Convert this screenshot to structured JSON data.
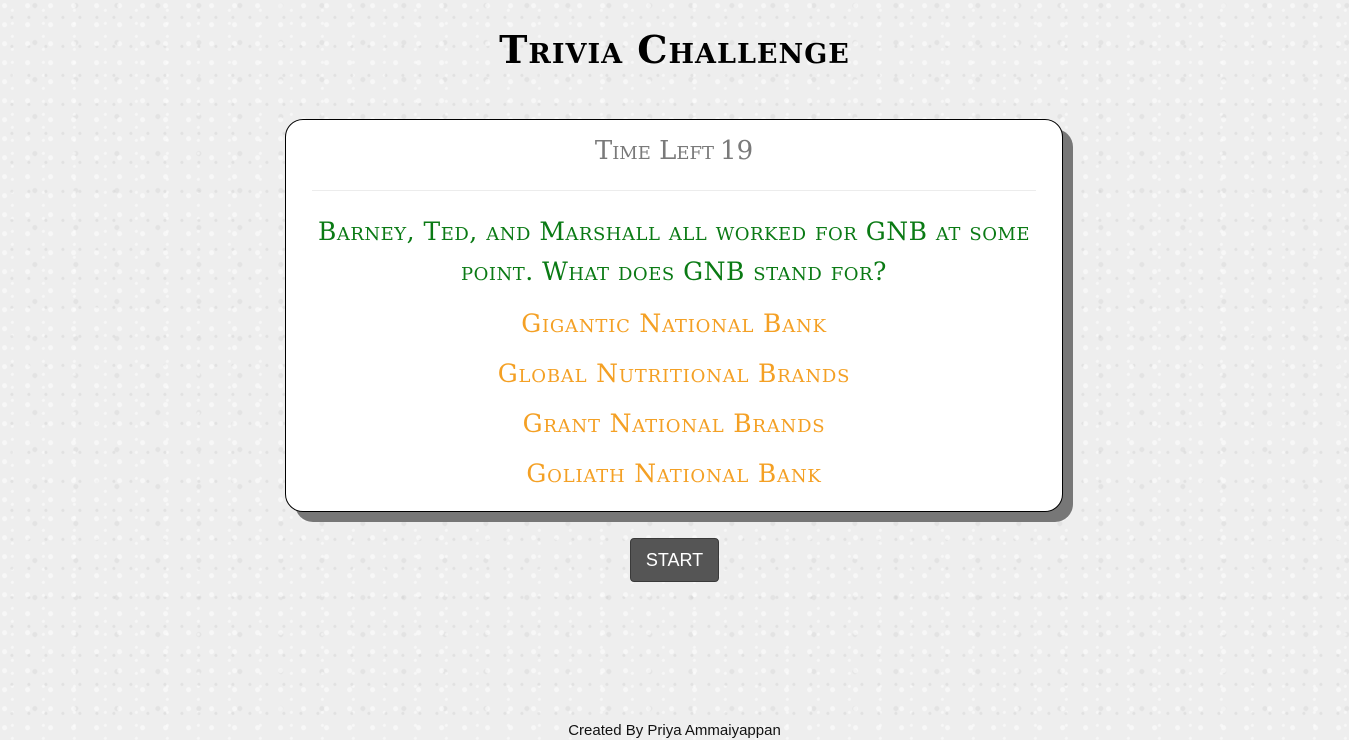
{
  "header": {
    "title": "Trivia Challenge"
  },
  "card": {
    "timer_label": "Time Left",
    "timer_value": "19",
    "question": "Barney, Ted, and Marshall all worked for GNB at some point. What does GNB stand for?",
    "answers": [
      "Gigantic National Bank",
      "Global Nutritional Brands",
      "Grant National Brands",
      "Goliath National Bank"
    ]
  },
  "controls": {
    "start_label": "START"
  },
  "footer": {
    "credit": "Created By Priya Ammaiyappan"
  },
  "colors": {
    "question": "#0a7a14",
    "answer": "#f4a024",
    "timer": "#7a7a7a",
    "button": "#555555"
  }
}
